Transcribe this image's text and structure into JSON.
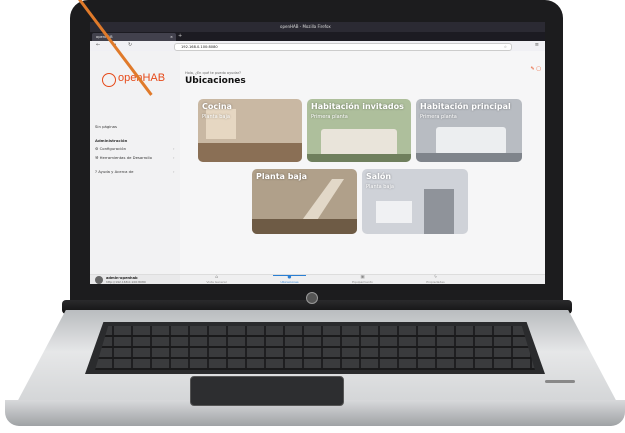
{
  "browser": {
    "window_title": "openHAB - Mozilla Firefox",
    "tab_title": "openHAB",
    "url": "192.168.0.100:8080"
  },
  "sidebar": {
    "logo_text": "openHAB",
    "items": [
      {
        "label": "Sin páginas"
      },
      {
        "label": "Administración"
      },
      {
        "label": "Configuración"
      },
      {
        "label": "Herramientas de Desarrollo"
      },
      {
        "label": "Ayuda y Acerca de"
      }
    ],
    "user": {
      "name": "admin-openhab",
      "address": "http://192.168.0.100:8080"
    }
  },
  "main": {
    "breadcrumb": "Hola, ¿En qué te puedo ayudar?",
    "title": "Ubicaciones",
    "cards": [
      {
        "name": "Cocina",
        "sub": "Planta baja",
        "colors": [
          "#c9b8a3",
          "#e6d7c2",
          "#8a6f55"
        ]
      },
      {
        "name": "Habitación invitados",
        "sub": "Primera planta",
        "colors": [
          "#aebf9c",
          "#e9e4da",
          "#6f7f5d"
        ]
      },
      {
        "name": "Habitación principal",
        "sub": "Primera planta",
        "colors": [
          "#b8bcc2",
          "#eceef0",
          "#7f848b"
        ]
      },
      {
        "name": "Planta baja",
        "sub": "",
        "colors": [
          "#b0a08a",
          "#e2d8c8",
          "#6e5b45"
        ]
      },
      {
        "name": "Salón",
        "sub": "Planta baja",
        "colors": [
          "#cfd2d8",
          "#f0f1f3",
          "#8f939a"
        ]
      }
    ]
  },
  "bottom_nav": [
    {
      "label": "Vista General",
      "icon": "home-icon",
      "active": false
    },
    {
      "label": "Ubicaciones",
      "icon": "location-icon",
      "active": true
    },
    {
      "label": "Equipamiento",
      "icon": "equipment-icon",
      "active": false
    },
    {
      "label": "Propiedades",
      "icon": "properties-icon",
      "active": false
    }
  ],
  "colors": {
    "accent": "#e64a19",
    "active_tab": "#2a7fd4"
  }
}
